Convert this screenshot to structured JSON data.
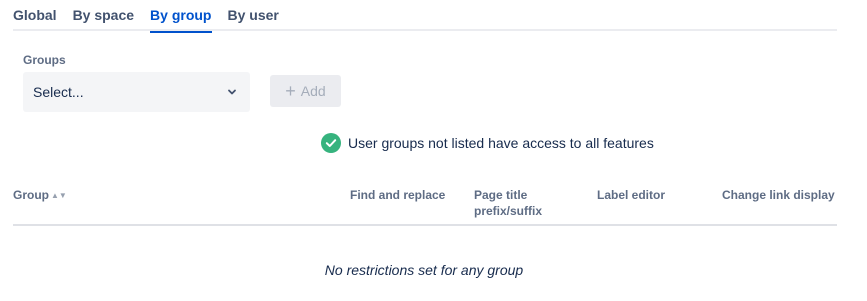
{
  "tabs": [
    {
      "label": "Global"
    },
    {
      "label": "By space"
    },
    {
      "label": "By group",
      "active": true
    },
    {
      "label": "By user"
    }
  ],
  "groups": {
    "label": "Groups",
    "placeholder": "Select...",
    "add_label": "Add"
  },
  "info_message": "User groups not listed have access to all features",
  "table": {
    "columns": [
      {
        "label": "Group",
        "sortable": true
      },
      {
        "label": "Find and replace"
      },
      {
        "label": "Page title prefix/suffix"
      },
      {
        "label": "Label editor"
      },
      {
        "label": "Change link display"
      }
    ],
    "empty_message": "No restrictions set for any group"
  },
  "colors": {
    "accent": "#0052cc",
    "success": "#36b37e",
    "muted": "#5e6c84"
  },
  "icons": [
    "chevron-down-icon",
    "plus-icon",
    "check-circle-icon",
    "sort-icon"
  ]
}
